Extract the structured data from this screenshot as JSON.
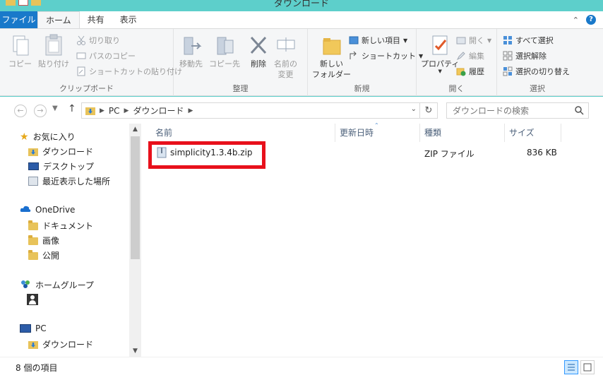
{
  "window": {
    "title": "ダウンロード"
  },
  "tabs": [
    {
      "label": "ファイル"
    },
    {
      "label": "ホーム"
    },
    {
      "label": "共有"
    },
    {
      "label": "表示"
    }
  ],
  "ribbon": {
    "clipboard": {
      "label": "クリップボード",
      "copy": "コピー",
      "paste": "貼り付け",
      "cut": "切り取り",
      "copy_path": "パスのコピー",
      "paste_shortcut": "ショートカットの貼り付け"
    },
    "organize": {
      "label": "整理",
      "move_to": "移動先",
      "copy_to": "コピー先",
      "delete": "削除",
      "rename_line1": "名前の",
      "rename_line2": "変更"
    },
    "new": {
      "label": "新規",
      "new_folder_line1": "新しい",
      "new_folder_line2": "フォルダー",
      "new_item": "新しい項目",
      "shortcut": "ショートカット"
    },
    "open": {
      "label": "開く",
      "properties": "プロパティ",
      "open": "開く",
      "edit": "編集",
      "history": "履歴"
    },
    "select": {
      "label": "選択",
      "select_all": "すべて選択",
      "select_none": "選択解除",
      "invert": "選択の切り替え"
    }
  },
  "address": {
    "segments": [
      "PC",
      "ダウンロード"
    ],
    "search_placeholder": "ダウンロードの検索"
  },
  "nav": {
    "favorites": "お気に入り",
    "fav_downloads": "ダウンロード",
    "fav_desktop": "デスクトップ",
    "fav_recent": "最近表示した場所",
    "onedrive": "OneDrive",
    "od_documents": "ドキュメント",
    "od_pictures": "画像",
    "od_public": "公開",
    "homegroup": "ホームグループ",
    "pc": "PC",
    "pc_downloads": "ダウンロード"
  },
  "columns": {
    "name": "名前",
    "modified": "更新日時",
    "type": "種類",
    "size": "サイズ"
  },
  "files": [
    {
      "name": "simplicity1.3.4b.zip",
      "modified": "",
      "type": "ZIP ファイル",
      "size": "836 KB"
    }
  ],
  "status": {
    "item_count": "8 個の項目"
  },
  "colors": {
    "accent": "#1979ca",
    "highlight": "#e8101b",
    "titlebar": "#5dcfcb"
  }
}
